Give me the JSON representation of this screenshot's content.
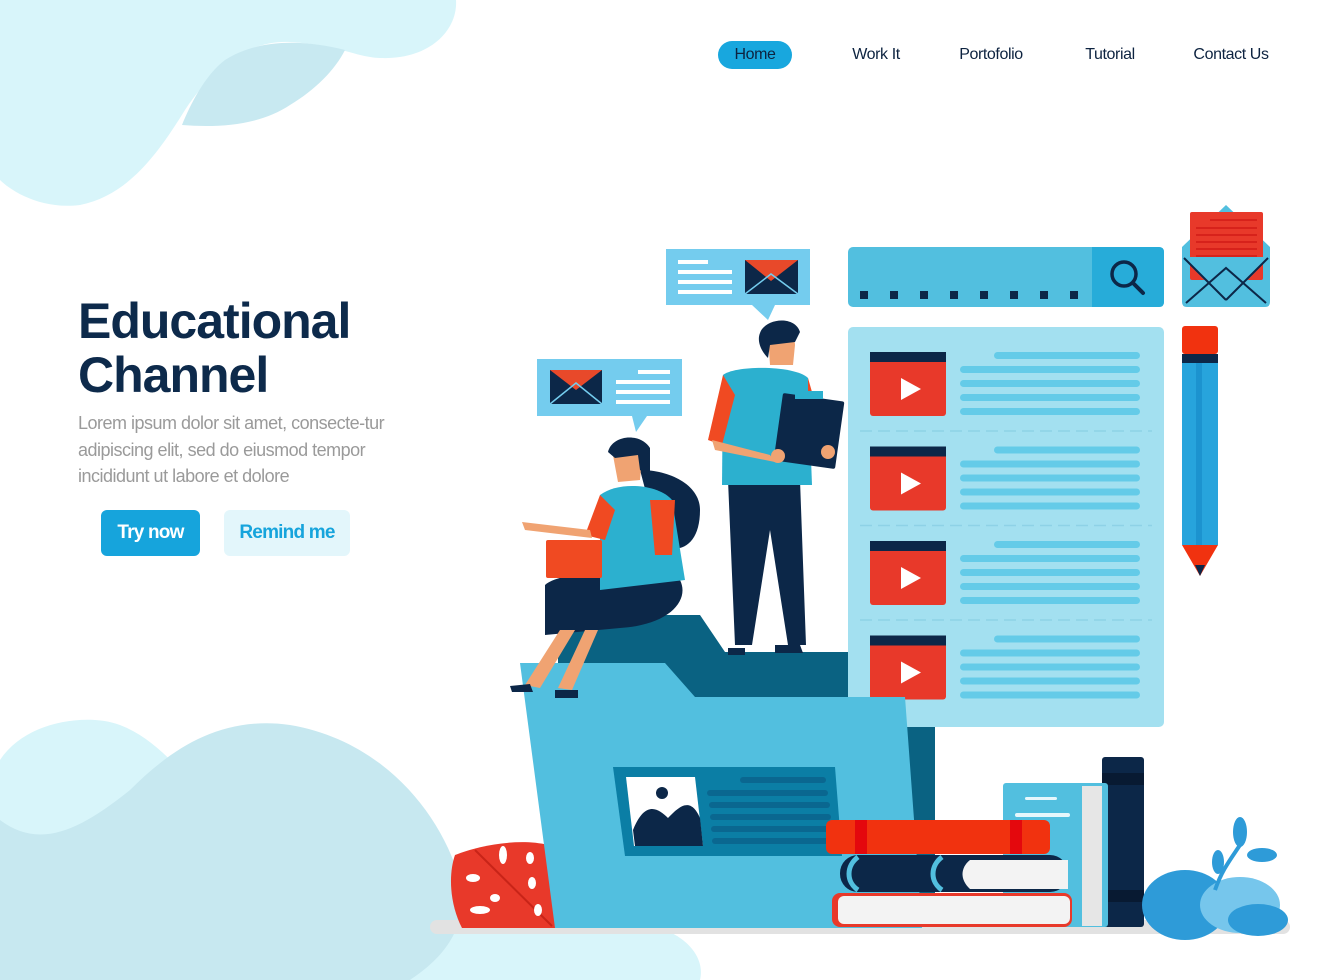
{
  "nav": {
    "items": [
      {
        "label": "Home",
        "active": true
      },
      {
        "label": "Work It",
        "active": false
      },
      {
        "label": "Portofolio",
        "active": false
      },
      {
        "label": "Tutorial",
        "active": false
      },
      {
        "label": "Contact Us",
        "active": false
      }
    ]
  },
  "hero": {
    "title_line1": "Educational",
    "title_line2": "Channel",
    "description": "Lorem ipsum dolor sit amet, consecte-tur adipiscing elit, sed do eiusmod tempor incididunt ut labore et dolore",
    "primary_button": "Try now",
    "secondary_button": "Remind me"
  },
  "illustration": {
    "video_list_count": 4,
    "search_placeholder_dots": 8
  },
  "colors": {
    "accent": "#16a4dc",
    "accent_light": "#e3f6fb",
    "heading": "#0d2a4b",
    "body_text": "#9a9a9a",
    "red": "#e8392a",
    "navy": "#0c2748",
    "panel_blue": "#a3e0f0",
    "mid_blue": "#52bfdf",
    "dark_teal": "#0a6282",
    "blob_light": "#d8f5fa",
    "blob_mid": "#c7e8f0"
  }
}
